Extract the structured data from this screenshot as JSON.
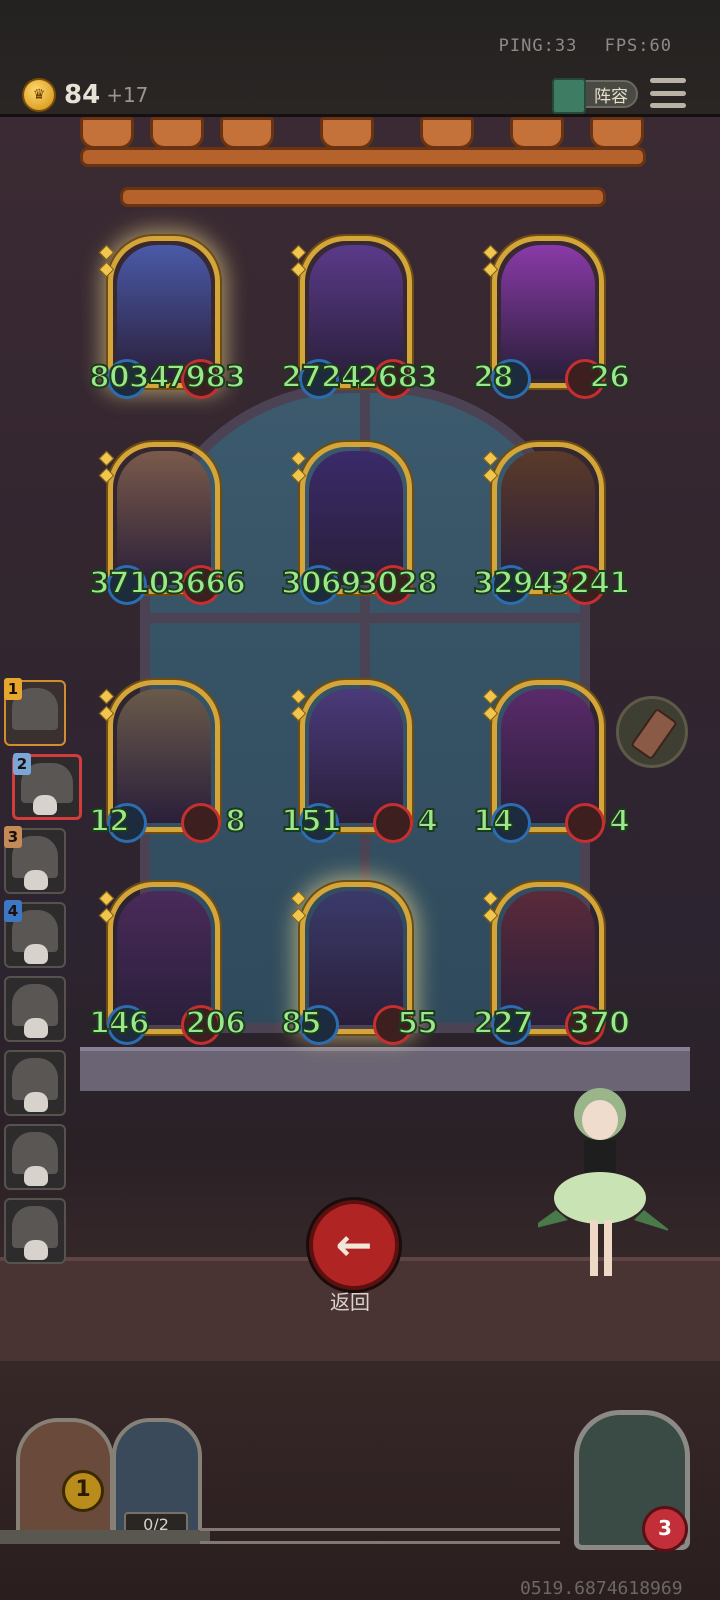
{
  "status": {
    "ping": "PING:33",
    "fps": "FPS:60"
  },
  "gold": {
    "value": "84",
    "income": "+17"
  },
  "team_button": {
    "label": "阵容"
  },
  "board": [
    {
      "atk": "8034",
      "hp": "7983",
      "art": "#4a5aa8",
      "glow": true
    },
    {
      "atk": "2724",
      "hp": "2683",
      "art": "#5a3a8a",
      "glow": false
    },
    {
      "atk": "28",
      "hp": "26",
      "art": "#8a3aa8",
      "glow": false
    },
    {
      "atk": "3710",
      "hp": "3666",
      "art": "#7a5a4a",
      "glow": false
    },
    {
      "atk": "3069",
      "hp": "3028",
      "art": "#3a2a6a",
      "glow": false
    },
    {
      "atk": "3294",
      "hp": "3241",
      "art": "#5a3a2a",
      "glow": false
    },
    {
      "atk": "12",
      "hp": "8",
      "art": "#6a5a4a",
      "glow": false
    },
    {
      "atk": "151",
      "hp": "4",
      "art": "#4a3a7a",
      "glow": false
    },
    {
      "atk": "14",
      "hp": "4",
      "art": "#5a2a6a",
      "glow": false
    },
    {
      "atk": "146",
      "hp": "206",
      "art": "#4a2a5a",
      "glow": false
    },
    {
      "atk": "85",
      "hp": "55",
      "art": "#3a3a6a",
      "glow": true
    },
    {
      "atk": "227",
      "hp": "370",
      "art": "#5a2a3a",
      "glow": false
    }
  ],
  "sidebar": [
    {
      "num": "1",
      "color": "#e7a72d"
    },
    {
      "num": "2",
      "color": "#7aa7d8"
    },
    {
      "num": "3",
      "color": "#c48a58"
    },
    {
      "num": "4",
      "color": "#3d78c4"
    },
    {
      "num": "",
      "color": ""
    },
    {
      "num": "",
      "color": ""
    },
    {
      "num": "",
      "color": ""
    },
    {
      "num": "",
      "color": ""
    }
  ],
  "back_button": {
    "label": "返回",
    "icon": "←"
  },
  "shop": {
    "level": "1",
    "slots": "0/2"
  },
  "player": {
    "health": "3"
  },
  "seed": "0519.6874618969"
}
